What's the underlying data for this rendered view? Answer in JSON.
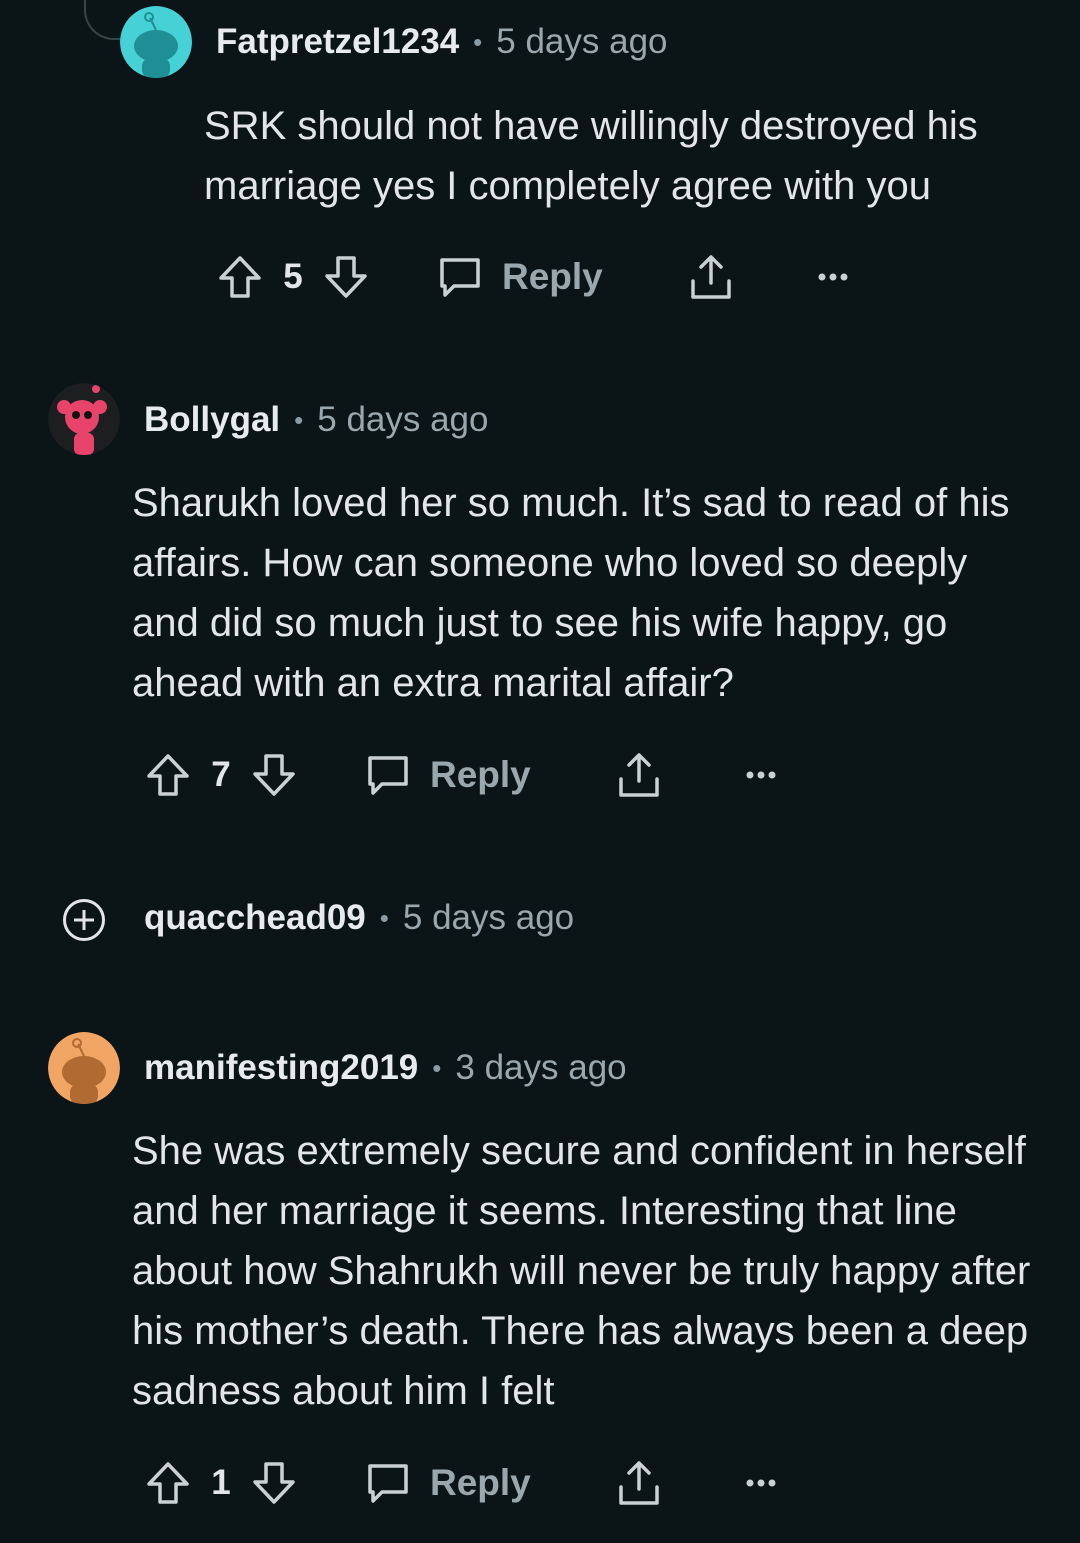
{
  "colors": {
    "background": "#0b1416",
    "text": "#e3e6e8",
    "muted": "#9aa8ae",
    "icon": "#c9d1d4"
  },
  "comments": [
    {
      "username": "Fatpretzel1234",
      "separator": "•",
      "time": "5 days ago",
      "avatar": "snoo-avatar-teal",
      "body": "SRK should not have willingly destroyed his marriage yes I completely agree with you",
      "votes": "5",
      "reply_label": "Reply"
    },
    {
      "username": "Bollygal",
      "separator": "•",
      "time": "5 days ago",
      "avatar": "snoo-avatar-pink",
      "body": "Sharukh loved her so much. It’s sad to read of his affairs. How can someone who loved so deeply and did so much just to see his wife happy, go ahead with an extra marital affair?",
      "votes": "7",
      "reply_label": "Reply"
    },
    {
      "username": "quacchead09",
      "separator": "•",
      "time": "5 days ago",
      "collapsed": true,
      "expand_icon": "plus-circle-icon"
    },
    {
      "username": "manifesting2019",
      "separator": "•",
      "time": "3 days ago",
      "avatar": "snoo-avatar-orange",
      "body": "She was extremely secure and confident in herself and her marriage it seems. Interesting that line about how Shahrukh will never be truly happy after his mother’s death. There has always been a deep sadness about him I felt",
      "votes": "1",
      "reply_label": "Reply"
    }
  ]
}
